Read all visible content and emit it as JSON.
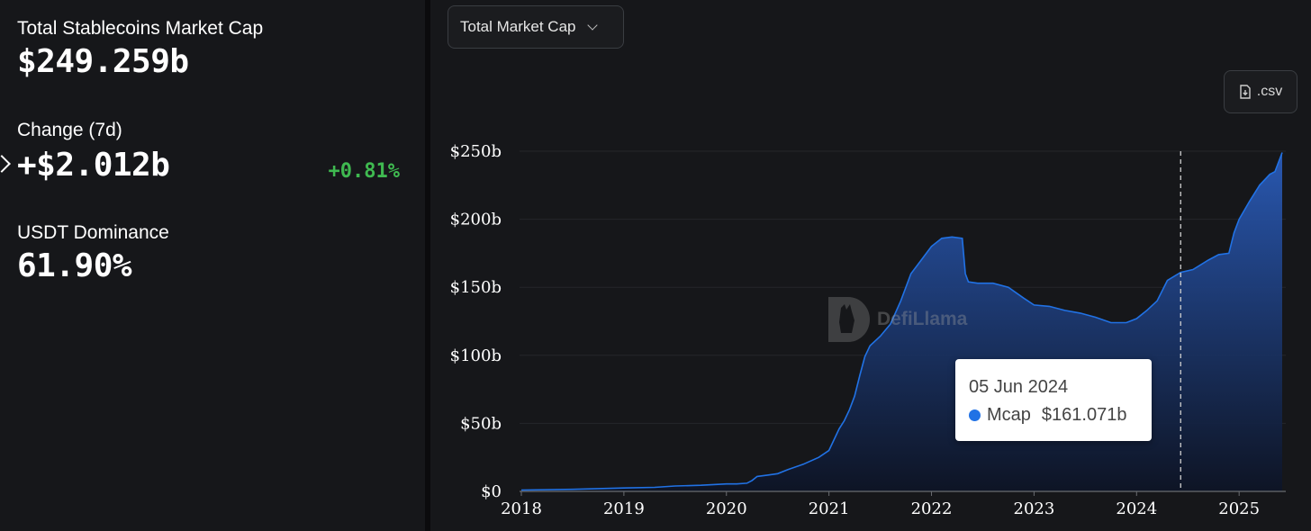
{
  "summary": {
    "total_label": "Total Stablecoins Market Cap",
    "total_value": "$249.259b",
    "change_label": "Change (7d)",
    "change_value": "+$2.012b",
    "change_pct": "+0.81%",
    "dominance_label": "USDT Dominance",
    "dominance_value": "61.90%"
  },
  "controls": {
    "metric_select": "Total Market Cap",
    "csv_label": ".csv"
  },
  "watermark": "DefiLlama",
  "tooltip": {
    "date": "05 Jun 2024",
    "series": "Mcap",
    "value": "$161.071b"
  },
  "colors": {
    "line": "#2172e5",
    "positive": "#3fb950",
    "background": "#16171a"
  },
  "chart_data": {
    "type": "area",
    "title": "",
    "xlabel": "",
    "ylabel": "",
    "x_ticks": [
      "2018",
      "2019",
      "2020",
      "2021",
      "2022",
      "2023",
      "2024",
      "2025"
    ],
    "y_ticks": [
      "$0",
      "$50b",
      "$100b",
      "$150b",
      "$200b",
      "$250b"
    ],
    "xlim": [
      2018.0,
      2025.42
    ],
    "ylim": [
      0,
      250
    ],
    "grid": true,
    "legend": "none",
    "highlight_x": 2024.43,
    "series": [
      {
        "name": "Mcap",
        "x": [
          2018.0,
          2018.5,
          2019.0,
          2019.3,
          2019.5,
          2019.75,
          2020.0,
          2020.1,
          2020.2,
          2020.25,
          2020.3,
          2020.4,
          2020.5,
          2020.6,
          2020.75,
          2020.9,
          2021.0,
          2021.05,
          2021.1,
          2021.15,
          2021.2,
          2021.25,
          2021.3,
          2021.35,
          2021.4,
          2021.5,
          2021.6,
          2021.7,
          2021.8,
          2021.9,
          2022.0,
          2022.1,
          2022.2,
          2022.3,
          2022.33,
          2022.36,
          2022.45,
          2022.6,
          2022.75,
          2022.9,
          2023.0,
          2023.15,
          2023.3,
          2023.45,
          2023.6,
          2023.75,
          2023.9,
          2024.0,
          2024.1,
          2024.2,
          2024.3,
          2024.43,
          2024.55,
          2024.7,
          2024.8,
          2024.9,
          2024.95,
          2025.0,
          2025.1,
          2025.2,
          2025.3,
          2025.35,
          2025.42
        ],
        "values": [
          1,
          1.5,
          2.5,
          3,
          4,
          4.5,
          5.5,
          5.5,
          6,
          8,
          11,
          12,
          13,
          16,
          20,
          25,
          30,
          38,
          46,
          52,
          60,
          70,
          85,
          99,
          107,
          114,
          123,
          140,
          160,
          170,
          180,
          186,
          187,
          186,
          160,
          154,
          153,
          153,
          150,
          142,
          137,
          136,
          133,
          131,
          128,
          124,
          124,
          127,
          133,
          140,
          155,
          161,
          163,
          170,
          174,
          175,
          190,
          200,
          213,
          225,
          233,
          235,
          249
        ]
      }
    ]
  }
}
